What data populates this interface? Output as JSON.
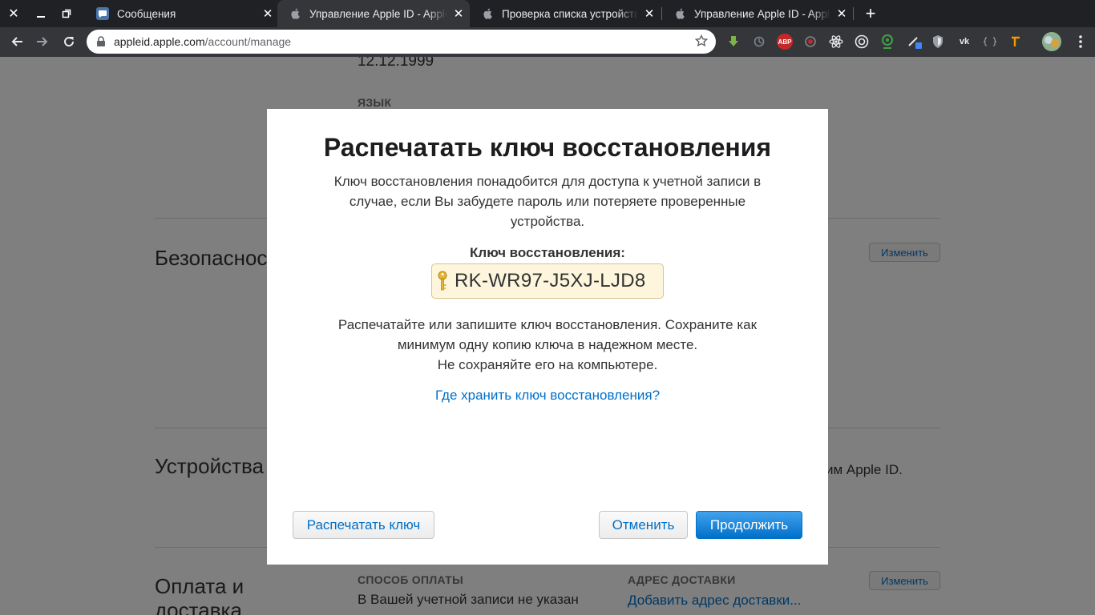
{
  "browser": {
    "tabs": [
      {
        "title": "Сообщения",
        "active": false
      },
      {
        "title": "Управление Apple ID - Apple",
        "active": true
      },
      {
        "title": "Проверка списка устройств",
        "active": false
      },
      {
        "title": "Управление Apple ID - Apple",
        "active": false
      }
    ],
    "url_host": "appleid.apple.com",
    "url_path": "/account/manage",
    "extensions": {
      "abp_label": "ABP",
      "vk_label": "vk"
    }
  },
  "page": {
    "birthday": "12.12.1999",
    "language_label": "ЯЗЫК",
    "security_title": "Безопасность",
    "devices_title": "Устройства",
    "devices_text": "им Apple ID.",
    "payment_title": "Оплата и доставка",
    "payment_method_label": "СПОСОБ ОПЛАТЫ",
    "payment_method_text": "В Вашей учетной записи не указан",
    "shipping_label": "АДРЕС ДОСТАВКИ",
    "add_shipping_link": "Добавить адрес доставки...",
    "edit_label": "Изменить"
  },
  "modal": {
    "title": "Распечатать ключ восстановления",
    "description_lines": [
      "Ключ восстановления понадобится для доступа к учетной записи в",
      "случае, если Вы забудете пароль или потеряете проверенные",
      "устройства."
    ],
    "key_label": "Ключ восстановления:",
    "key_value": "RK-WR97-J5XJ-LJD8",
    "note_lines": [
      "Распечатайте или запишите ключ восстановления. Сохраните как",
      "минимум одну копию ключа в надежном месте.",
      "Не сохраняйте его на компьютере."
    ],
    "help_link": "Где хранить ключ восстановления?",
    "print_button": "Распечатать ключ",
    "cancel_button": "Отменить",
    "continue_button": "Продолжить"
  },
  "colors": {
    "accent": "#0070c9",
    "key_background": "#fdf6dd"
  }
}
